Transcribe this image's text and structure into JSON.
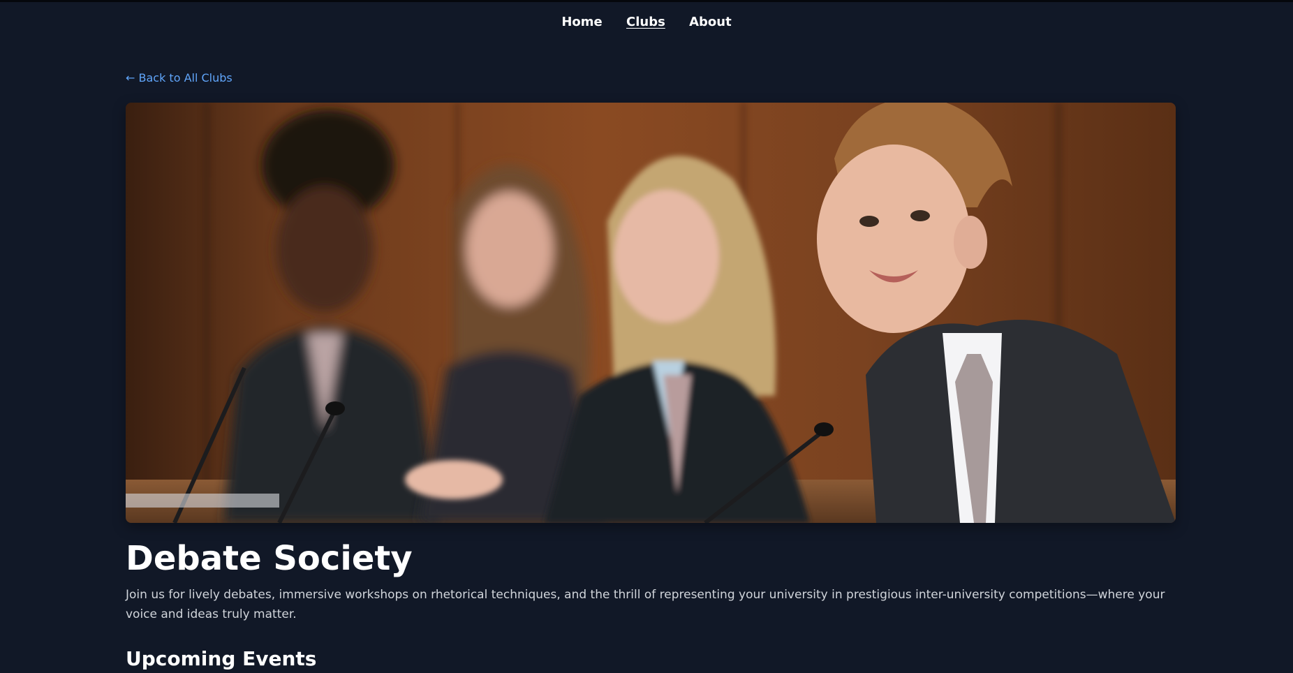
{
  "nav": {
    "items": [
      {
        "label": "Home",
        "active": false
      },
      {
        "label": "Clubs",
        "active": true
      },
      {
        "label": "About",
        "active": false
      }
    ]
  },
  "back_link": "← Back to All Clubs",
  "hero": {
    "image": "students-debate-panel-photo"
  },
  "club": {
    "title": "Debate Society",
    "description": "Join us for lively debates, immersive workshops on rhetorical techniques, and the thrill of representing your university in prestigious inter-university competitions—where your voice and ideas truly matter."
  },
  "sections": {
    "events_title": "Upcoming Events"
  },
  "colors": {
    "background": "#111827",
    "link": "#60a5fa",
    "text_muted": "#d1d5db"
  }
}
